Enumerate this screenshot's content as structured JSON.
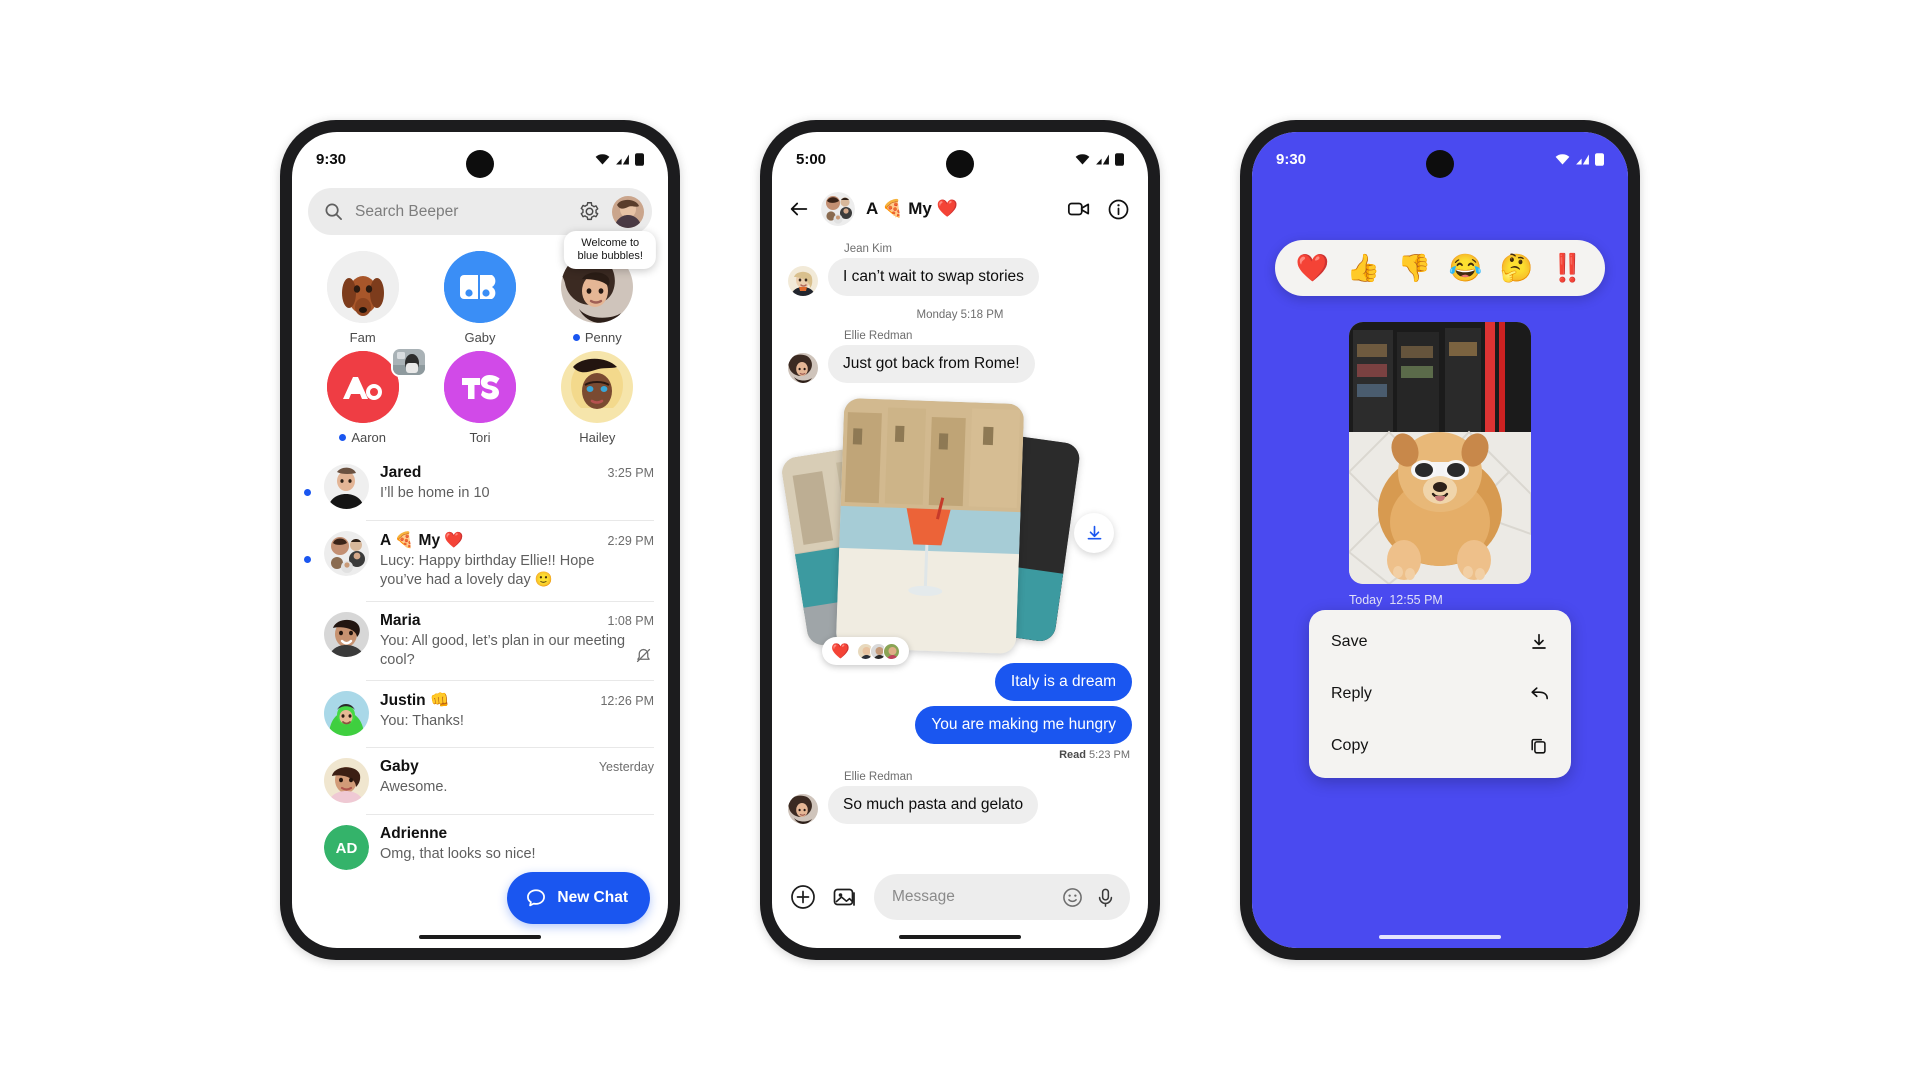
{
  "phone_inbox": {
    "status": {
      "time": "9:30",
      "wifi": "wifi-icon",
      "signal": "cellular-icon",
      "battery": "battery-icon"
    },
    "search": {
      "placeholder": "Search Beeper",
      "search_icon": "search-icon",
      "settings_icon": "gear-icon",
      "avatar": "profile-avatar"
    },
    "tooltip": "Welcome to blue bubbles!",
    "pins": [
      {
        "name": "Fam",
        "kind": "photo",
        "unread": false,
        "color": "#ececec"
      },
      {
        "name": "Gaby",
        "kind": "logo",
        "unread": false,
        "color": "#3a8ef6"
      },
      {
        "name": "Penny",
        "kind": "photo",
        "unread": true,
        "color": "#6d5145"
      },
      {
        "name": "Aaron",
        "kind": "logo",
        "unread": true,
        "color": "#ef3d44"
      },
      {
        "name": "Tori",
        "kind": "logo",
        "unread": false,
        "color": "#d14ae8"
      },
      {
        "name": "Hailey",
        "kind": "photo",
        "unread": false,
        "color": "#f5e2a8"
      }
    ],
    "chats": [
      {
        "title": "Jared",
        "time": "3:25 PM",
        "preview": "I’ll be home in 10",
        "unread": true,
        "muted": false
      },
      {
        "title": "A 🍕 My ❤️",
        "time": "2:29 PM",
        "preview": "Lucy: Happy birthday Ellie!! Hope you’ve had a lovely day  🙂",
        "unread": true,
        "muted": false
      },
      {
        "title": "Maria",
        "time": "1:08 PM",
        "preview": "You: All good, let’s plan in our meeting cool?",
        "unread": false,
        "muted": true
      },
      {
        "title": "Justin 👊",
        "time": "12:26 PM",
        "preview": "You: Thanks!",
        "unread": false,
        "muted": false
      },
      {
        "title": "Gaby",
        "time": "Yesterday",
        "preview": "Awesome.",
        "unread": false,
        "muted": false
      },
      {
        "title": "Adrienne",
        "time": "",
        "preview": "Omg, that looks so nice!",
        "unread": false,
        "muted": false
      }
    ],
    "new_chat": {
      "label": "New Chat",
      "icon": "chat-bubble-icon"
    }
  },
  "phone_conversation": {
    "status": {
      "time": "5:00"
    },
    "header": {
      "back_icon": "back-arrow-icon",
      "title": "A 🍕 My ❤️",
      "video_icon": "video-call-icon",
      "info_icon": "info-icon"
    },
    "messages": [
      {
        "type": "in",
        "sender": "Jean Kim",
        "text": "I can’t wait to swap stories"
      },
      {
        "type": "day",
        "text": "Monday 5:18 PM"
      },
      {
        "type": "in",
        "sender": "Ellie Redman",
        "text": "Just got back from Rome!"
      },
      {
        "type": "photos",
        "reaction": "❤️",
        "download_icon": "download-icon"
      },
      {
        "type": "out",
        "text": "Italy is a dream"
      },
      {
        "type": "out",
        "text": "You are making me hungry"
      },
      {
        "type": "read",
        "label": "Read",
        "time": "5:23 PM"
      },
      {
        "type": "in",
        "sender": "Ellie Redman",
        "text": "So much pasta and gelato"
      }
    ],
    "composer": {
      "plus_icon": "add-attachment-icon",
      "gallery_icon": "gallery-icon",
      "placeholder": "Message",
      "emoji_icon": "emoji-icon",
      "mic_icon": "microphone-icon"
    }
  },
  "phone_media": {
    "status": {
      "time": "9:30"
    },
    "background_color": "#4a4af0",
    "reactions": [
      "❤️",
      "👍",
      "👎",
      "😂",
      "🤔",
      "‼️"
    ],
    "media": {
      "alt": "dog-photo",
      "day": "Today",
      "time": "12:55 PM"
    },
    "context_menu": [
      {
        "label": "Save",
        "icon": "download-icon"
      },
      {
        "label": "Reply",
        "icon": "reply-arrow-icon"
      },
      {
        "label": "Copy",
        "icon": "copy-icon"
      }
    ]
  }
}
